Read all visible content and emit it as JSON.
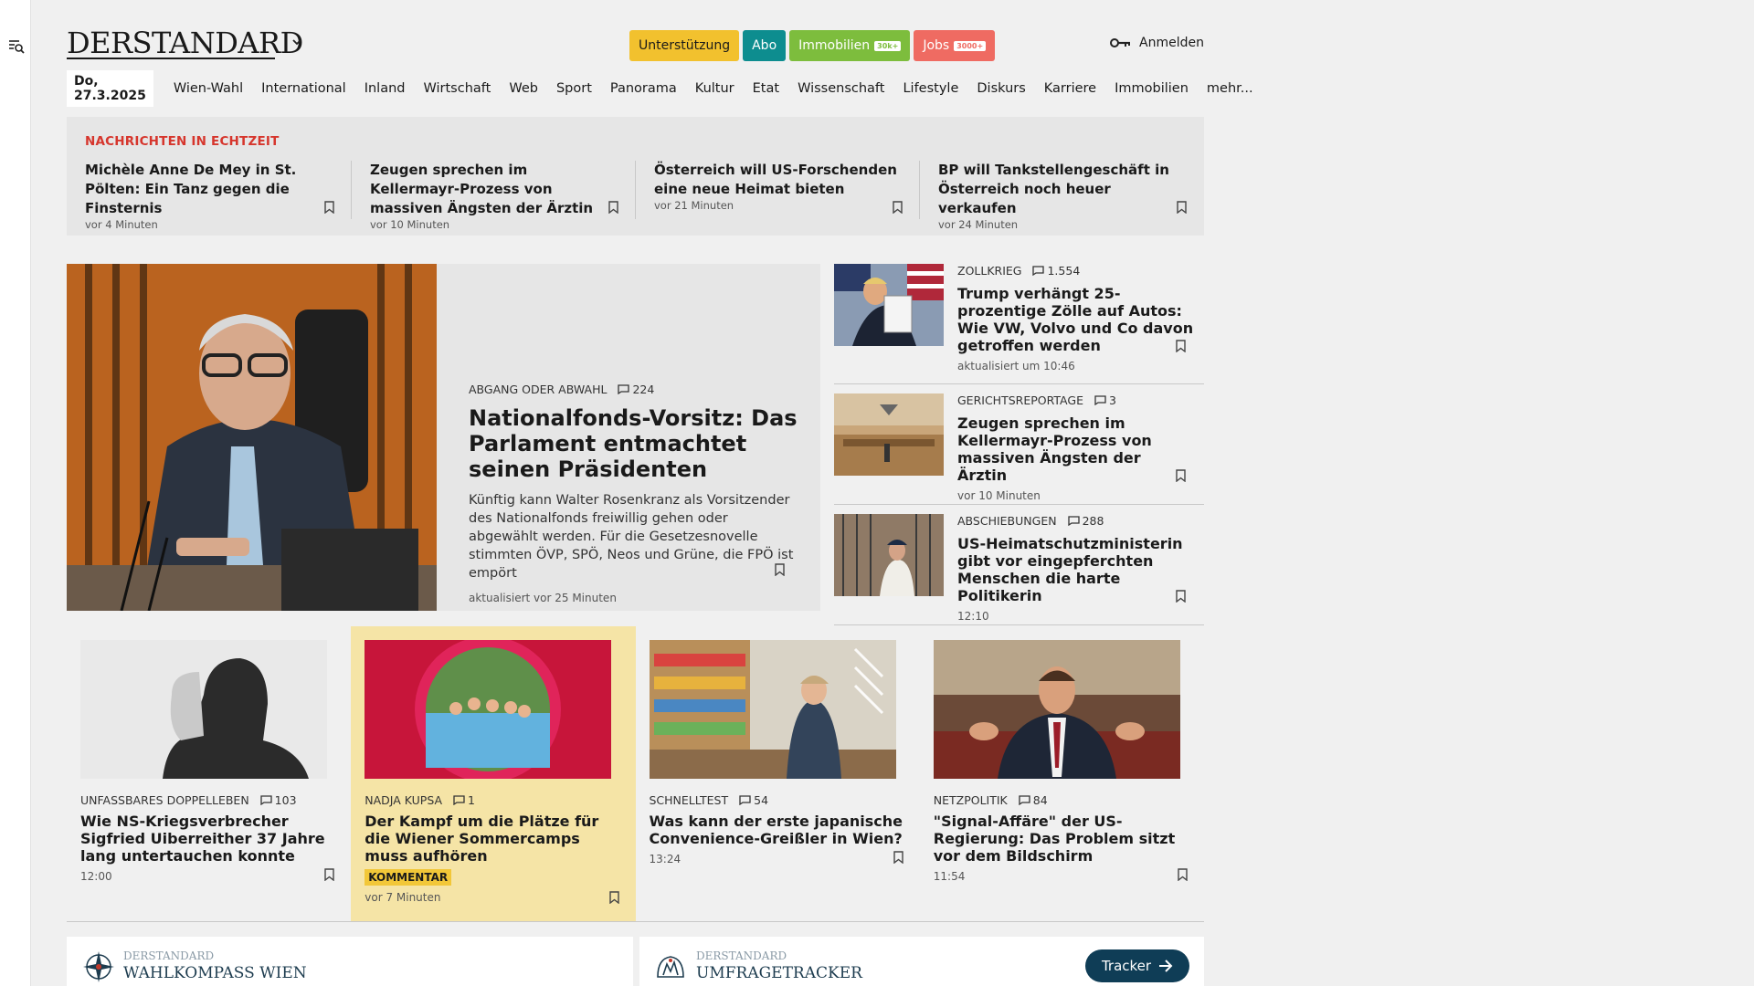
{
  "header": {
    "logo": "DERSTANDARD",
    "pills": [
      {
        "label": "Unterstützung",
        "tag": "",
        "bg": "#f2c12e",
        "color": "#1a1a1a"
      },
      {
        "label": "Abo",
        "tag": "",
        "bg": "#0d8d8f",
        "color": "#ffffff"
      },
      {
        "label": "Immobilien",
        "tag": "30k+",
        "bg": "#7dbd3d",
        "color": "#ffffff"
      },
      {
        "label": "Jobs",
        "tag": "3000+",
        "bg": "#ef6b62",
        "color": "#ffffff"
      }
    ],
    "login": "Anmelden"
  },
  "nav": {
    "date": "Do, 27.3.2025",
    "items": [
      "Wien-Wahl",
      "International",
      "Inland",
      "Wirtschaft",
      "Web",
      "Sport",
      "Panorama",
      "Kultur",
      "Etat",
      "Wissenschaft",
      "Lifestyle",
      "Diskurs",
      "Karriere",
      "Immobilien",
      "mehr..."
    ]
  },
  "ticker": {
    "title": "NACHRICHTEN IN ECHTZEIT",
    "items": [
      {
        "headline": "Michèle Anne De Mey in St. Pölten: Ein Tanz gegen die Finsternis",
        "time": "vor 4 Minuten"
      },
      {
        "headline": "Zeugen sprechen im Kellermayr-Prozess von massiven Ängsten der Ärztin",
        "time": "vor 10 Minuten"
      },
      {
        "headline": "Österreich will US-Forschenden eine neue Heimat bieten",
        "time": "vor 21 Minuten"
      },
      {
        "headline": "BP will Tankstellengeschäft in Österreich noch heuer verkaufen",
        "time": "vor 24 Minuten"
      }
    ]
  },
  "lead": {
    "kicker": "ABGANG ODER ABWAHL",
    "comments": "224",
    "title": "Nationalfonds-Vorsitz: Das Parlament entmachtet seinen Präsidenten",
    "teaser": "Künftig kann Walter Rosenkranz als Vorsitzender des Nationalfonds freiwillig gehen oder abgewählt werden. Für die Gesetzesnovelle stimmten ÖVP, SPÖ, Neos und Grüne, die FPÖ ist empört",
    "meta": "aktualisiert vor 25 Minuten"
  },
  "side": [
    {
      "kicker": "ZOLLKRIEG",
      "comments": "1.554",
      "title": "Trump verhängt 25-prozentige Zölle auf Autos: Wie VW, Volvo und Co davon getroffen werden",
      "meta": "aktualisiert um 10:46"
    },
    {
      "kicker": "GERICHTSREPORTAGE",
      "comments": "3",
      "title": "Zeugen sprechen im Kellermayr-Prozess von massiven Ängsten der Ärztin",
      "meta": "vor 10 Minuten"
    },
    {
      "kicker": "ABSCHIEBUNGEN",
      "comments": "288",
      "title": "US-Heimatschutzministerin gibt vor eingepferchten Menschen die harte Politikerin",
      "meta": "12:10"
    }
  ],
  "cards": [
    {
      "kicker": "UNFASSBARES DOPPELLEBEN",
      "comments": "103",
      "title": "Wie NS-Kriegsverbrecher Sigfried Uiberreither 37 Jahre lang untertauchen konnte",
      "badge": "",
      "meta": "12:00"
    },
    {
      "kicker": "NADJA KUPSA",
      "comments": "1",
      "title": "Der Kampf um die Plätze für die Wiener Sommercamps muss aufhören",
      "badge": "KOMMENTAR",
      "meta": "vor 7 Minuten"
    },
    {
      "kicker": "SCHNELLTEST",
      "comments": "54",
      "title": "Was kann der erste japanische Convenience-Greißler in Wien?",
      "badge": "",
      "meta": "13:24"
    },
    {
      "kicker": "NETZPOLITIK",
      "comments": "84",
      "title": "\"Signal-Affäre\" der US-Regierung: Das Problem sitzt vor dem Bildschirm",
      "badge": "",
      "meta": "11:54"
    }
  ],
  "widgets": {
    "left": {
      "small": "DERSTANDARD",
      "big": "WAHLKOMPASS WIEN"
    },
    "right": {
      "small": "DERSTANDARD",
      "big": "UMFRAGETRACKER",
      "button": "Tracker"
    }
  }
}
